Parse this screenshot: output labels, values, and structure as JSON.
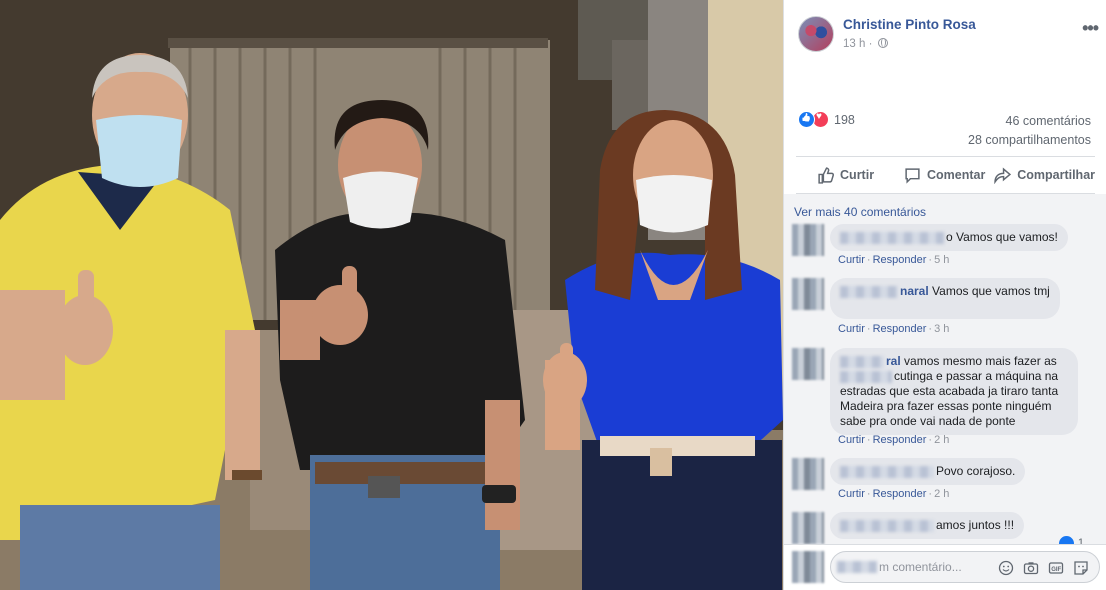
{
  "post": {
    "author": "Christine Pinto Rosa",
    "time": "13 h ·",
    "reaction_count": "198",
    "comments_count": "46 comentários",
    "shares_count": "28 compartilhamentos"
  },
  "actions": {
    "like": "Curtir",
    "comment": "Comentar",
    "share": "Compartilhar"
  },
  "comments_section": {
    "view_more": "Ver mais 40 comentários",
    "items": [
      {
        "visible_text": "o Vamos que vamos!",
        "name_tail": "",
        "reply": "Responder",
        "like": "Curtir",
        "time": "5 h"
      },
      {
        "visible_text": "Vamos que vamos tmj",
        "name_tail": "naral",
        "reply": "Responder",
        "like": "Curtir",
        "time": "3 h"
      },
      {
        "visible_text": "vamos mesmo mais fazer as",
        "name_tail": "ral",
        "line2": "cutinga e passar a máquina na",
        "line3": "estradas que esta acabada ja tiraro tanta",
        "line4": "Madeira pra fazer essas ponte ninguém",
        "line5": "sabe pra onde vai nada de ponte",
        "reply": "Responder",
        "like": "Curtir",
        "time": "2 h"
      },
      {
        "visible_text": "Povo corajoso.",
        "name_tail": "",
        "reply": "Responder",
        "like": "Curtir",
        "time": "2 h"
      },
      {
        "visible_text": "amos juntos !!!",
        "name_tail": "",
        "like_count": "1"
      }
    ]
  },
  "composer": {
    "placeholder": "m comentário..."
  },
  "icons": {
    "photo_subject": "three-people-thumbs-up-photo",
    "emoji": "emoji-icon",
    "camera": "camera-icon",
    "gif": "gif-icon",
    "sticker": "sticker-icon"
  },
  "colors": {
    "link": "#385898",
    "like_blue": "#1877f2",
    "love_red": "#f33e58"
  }
}
